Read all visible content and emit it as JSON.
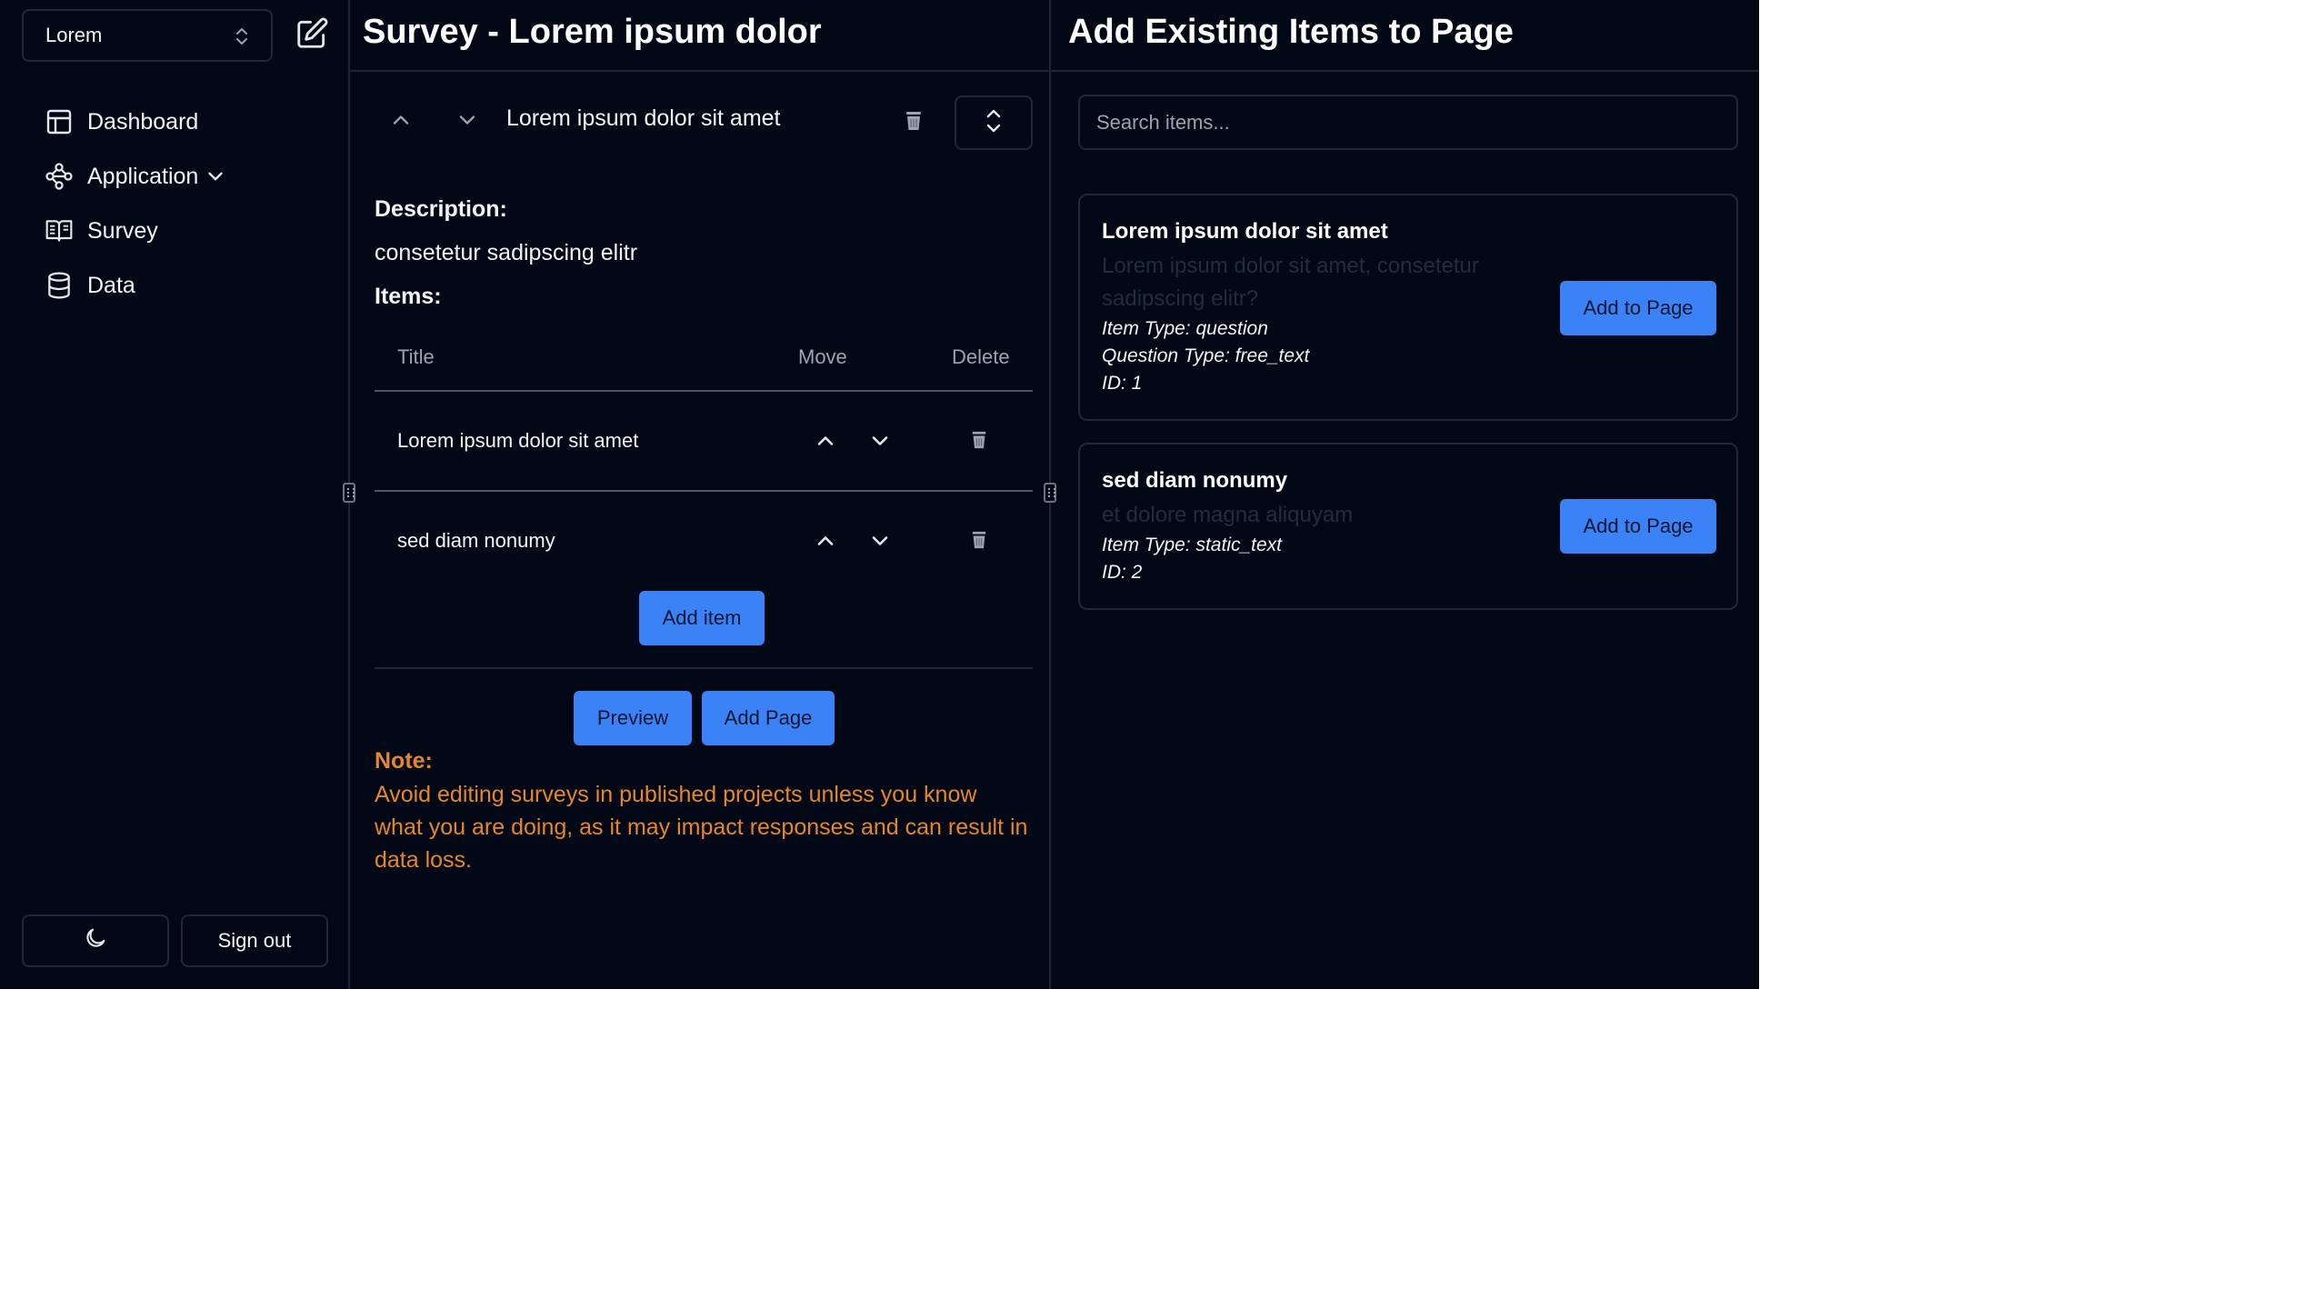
{
  "sidebar": {
    "project_select": "Lorem",
    "nav": [
      {
        "label": "Dashboard",
        "icon": "dashboard-icon"
      },
      {
        "label": "Application",
        "icon": "workflow-icon",
        "expandable": true
      },
      {
        "label": "Survey",
        "icon": "book-open-icon"
      },
      {
        "label": "Data",
        "icon": "database-icon"
      }
    ],
    "theme_toggle_icon": "moon-icon",
    "sign_out": "Sign out"
  },
  "survey": {
    "header": "Survey - Lorem ipsum dolor",
    "page_title": "Lorem ipsum dolor sit amet",
    "description_label": "Description:",
    "description": "consetetur sadipscing elitr",
    "items_label": "Items:",
    "columns": {
      "title": "Title",
      "move": "Move",
      "delete": "Delete"
    },
    "items": [
      {
        "title": "Lorem ipsum dolor sit amet"
      },
      {
        "title": "sed diam nonumy"
      }
    ],
    "add_item": "Add item",
    "preview": "Preview",
    "add_page": "Add Page",
    "note_label": "Note:",
    "note_text": "Avoid editing surveys in published projects unless you know what you are doing, as it may impact responses and can result in data loss."
  },
  "existing": {
    "header": "Add Existing Items to Page",
    "search_placeholder": "Search items...",
    "cards": [
      {
        "title": "Lorem ipsum dolor sit amet",
        "description": "Lorem ipsum dolor sit amet, consetetur sadipscing elitr?",
        "item_type": "Item Type: question",
        "question_type": "Question Type: free_text",
        "id": "ID: 1",
        "button": "Add to Page"
      },
      {
        "title": "sed diam nonumy",
        "description": "et dolore magna aliquyam",
        "item_type": "Item Type: static_text",
        "id": "ID: 2",
        "button": "Add to Page"
      }
    ]
  },
  "colors": {
    "background": "#030817",
    "border": "#1f2738",
    "accent": "#3b82f6",
    "note": "#e6862b",
    "muted": "#9ca3af"
  }
}
